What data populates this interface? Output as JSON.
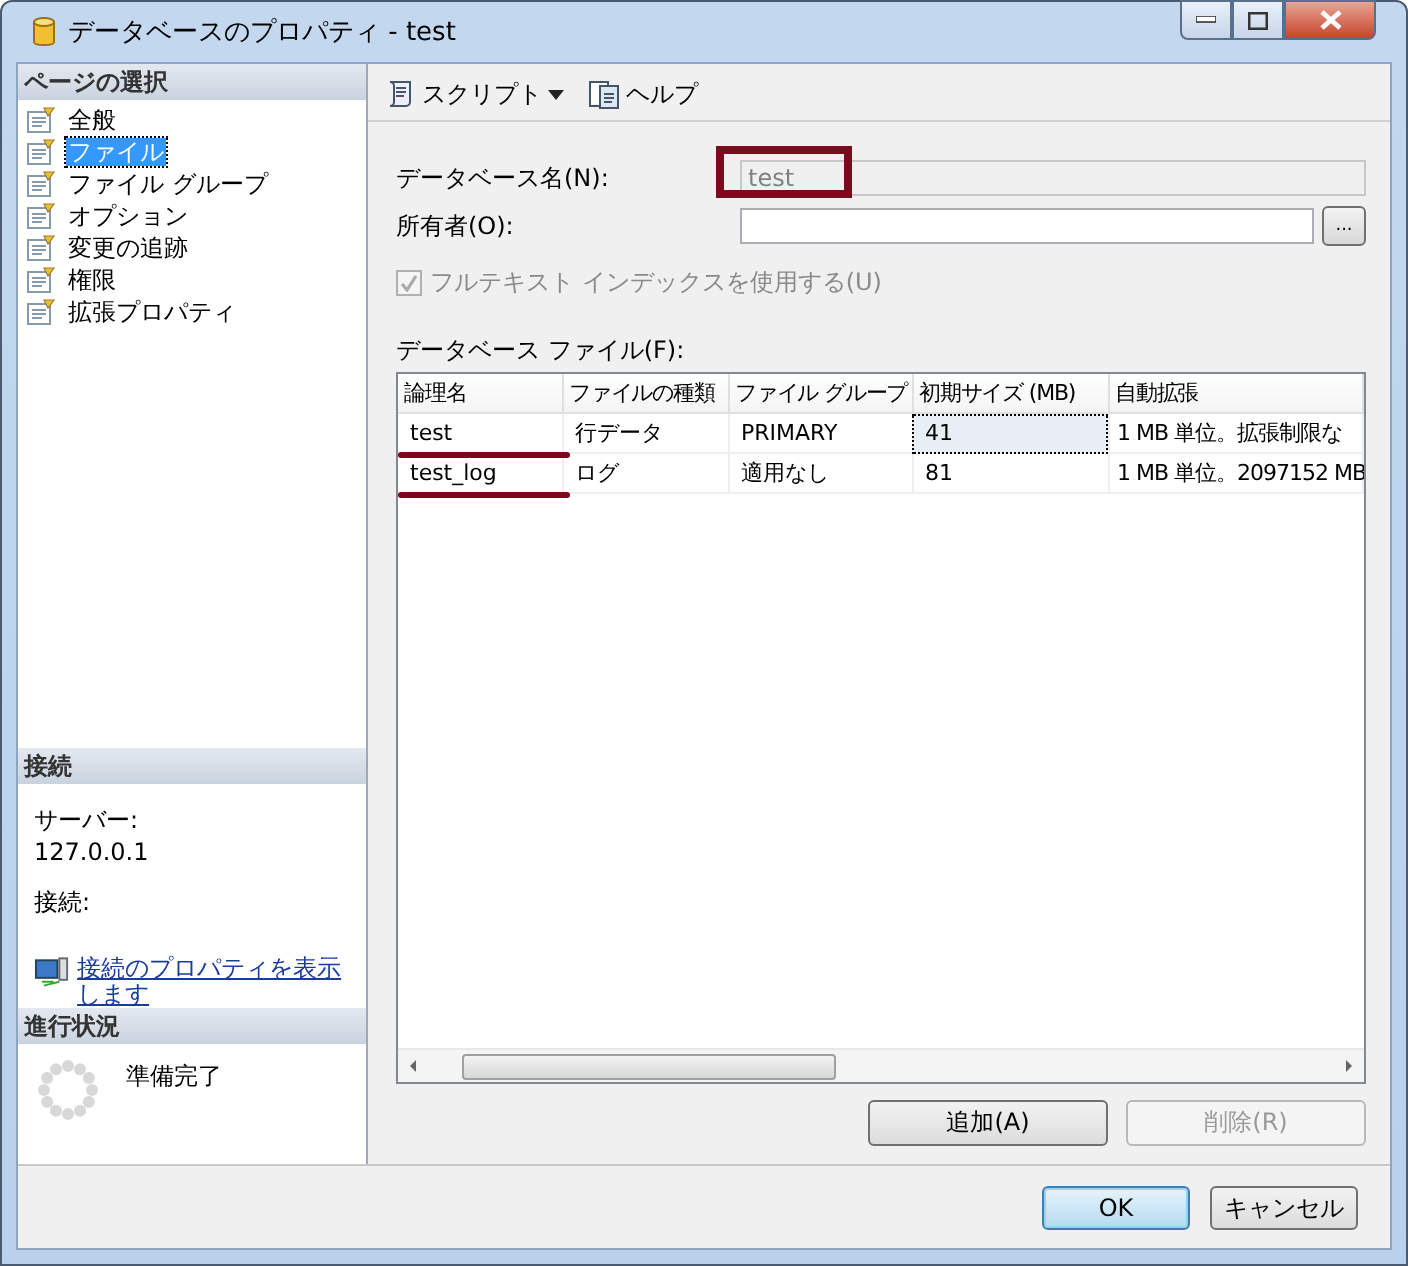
{
  "window": {
    "title": "データベースのプロパティ - test"
  },
  "sidebar": {
    "heading": "ページの選択",
    "items": [
      {
        "label": "全般",
        "selected": false
      },
      {
        "label": "ファイル",
        "selected": true
      },
      {
        "label": "ファイル グループ",
        "selected": false
      },
      {
        "label": "オプション",
        "selected": false
      },
      {
        "label": "変更の追跡",
        "selected": false
      },
      {
        "label": "権限",
        "selected": false
      },
      {
        "label": "拡張プロパティ",
        "selected": false
      }
    ]
  },
  "connection": {
    "heading": "接続",
    "server_label": "サーバー:",
    "server": "127.0.0.1",
    "connection_label": "接続:",
    "link": "接続のプロパティを表示します"
  },
  "progress": {
    "heading": "進行状況",
    "status": "準備完了"
  },
  "toolbar": [
    {
      "label": "スクリプト",
      "kind": "dropdown"
    },
    {
      "label": "ヘルプ",
      "kind": "button"
    }
  ],
  "form": {
    "db_name": {
      "label": "データベース名(N):",
      "value": "test",
      "disabled": true,
      "highlighted": true
    },
    "owner": {
      "label": "所有者(O):",
      "browse_button": "..."
    },
    "fulltext": {
      "label": "フルテキスト インデックスを使用する(U)",
      "checked": true,
      "disabled": true
    }
  },
  "files": {
    "label": "データベース ファイル(F):",
    "columns": [
      "論理名",
      "ファイルの種類",
      "ファイル グループ",
      "初期サイズ (MB)",
      "自動拡張"
    ],
    "rows": [
      {
        "underlined": true,
        "cells": [
          {
            "text": "test",
            "focused": false
          },
          {
            "text": "行データ",
            "focused": false
          },
          {
            "text": "PRIMARY",
            "focused": false
          },
          {
            "text": "41",
            "focused": true
          },
          {
            "text": "1 MB 単位。拡張制限な",
            "focused": false
          }
        ]
      },
      {
        "underlined": true,
        "cells": [
          {
            "text": "test_log",
            "focused": false
          },
          {
            "text": "ログ",
            "focused": false
          },
          {
            "text": "適用なし",
            "focused": false
          },
          {
            "text": "81",
            "focused": false
          },
          {
            "text": "1 MB 単位。2097152 MB",
            "focused": false
          }
        ]
      }
    ],
    "buttons": [
      {
        "label": "追加(A)",
        "disabled": false
      },
      {
        "label": "削除(R)",
        "disabled": true
      }
    ]
  },
  "footer": [
    {
      "label": "OK",
      "default": true
    },
    {
      "label": "キャンセル",
      "default": false
    }
  ]
}
